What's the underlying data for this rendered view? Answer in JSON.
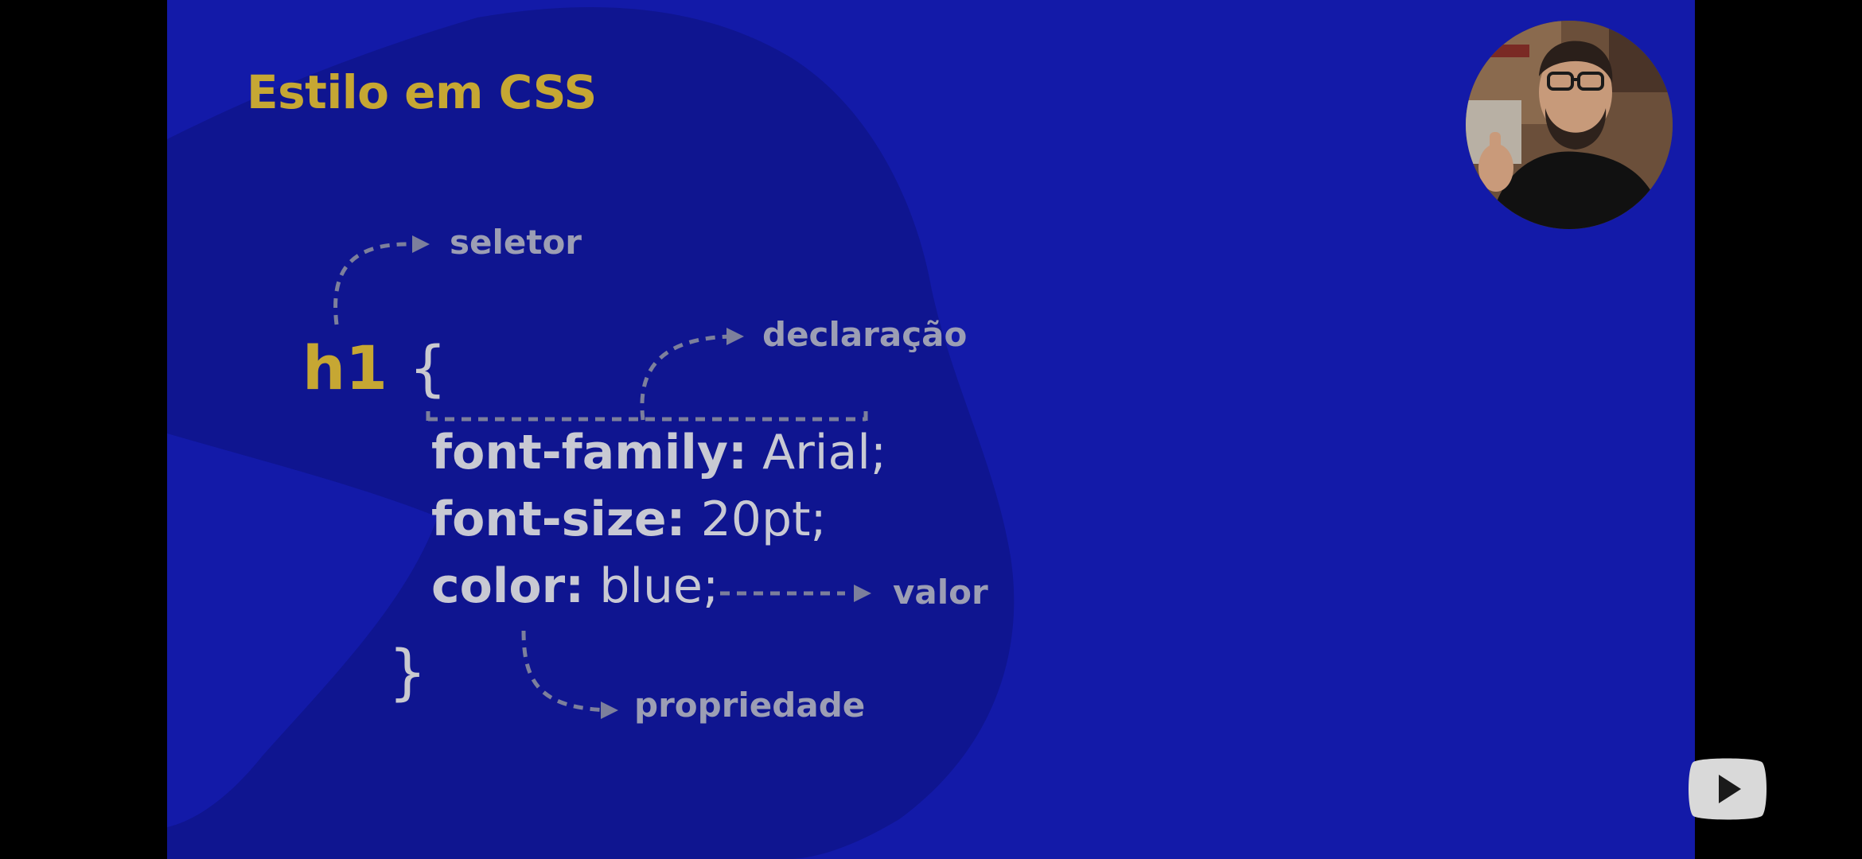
{
  "slide": {
    "title": "Estilo em CSS",
    "selector": "h1",
    "open_brace": "{",
    "close_brace": "}",
    "declarations": [
      {
        "property": "font-family:",
        "value": "Arial;"
      },
      {
        "property": "font-size:",
        "value": "20pt;"
      },
      {
        "property": "color:",
        "value": "blue;"
      }
    ],
    "labels": {
      "selector": "seletor",
      "declaration": "declaração",
      "value": "valor",
      "property": "propriedade"
    }
  },
  "colors": {
    "background": "#131aa8",
    "blob": "#0f1590",
    "title": "#c6a733",
    "annotation": "#9c9eb4"
  },
  "icons": {
    "player": "youtube-play-icon",
    "presenter": "presenter-webcam-overlay"
  }
}
